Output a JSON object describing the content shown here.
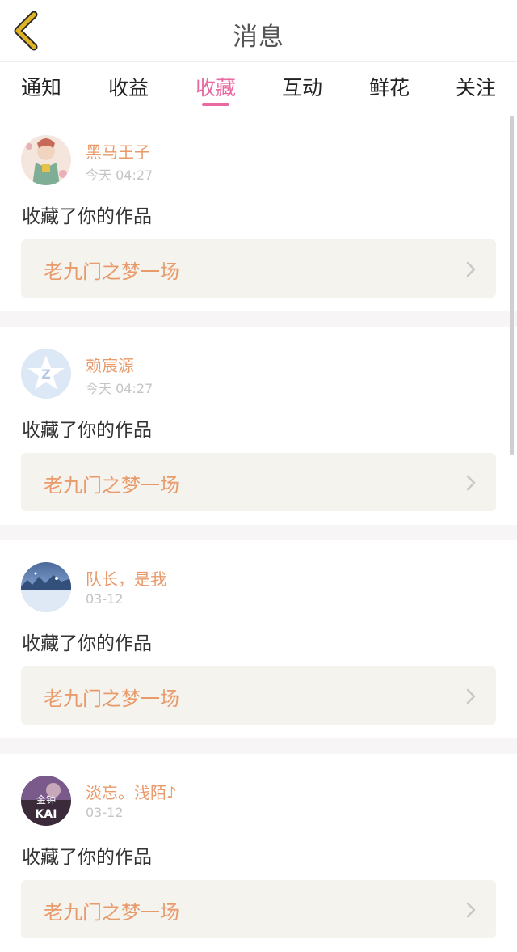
{
  "header": {
    "title": "消息"
  },
  "tabs": [
    {
      "label": "通知"
    },
    {
      "label": "收益"
    },
    {
      "label": "收藏"
    },
    {
      "label": "互动"
    },
    {
      "label": "鲜花"
    },
    {
      "label": "关注"
    }
  ],
  "active_tab": "收藏",
  "items": [
    {
      "username": "黑马王子",
      "time": "今天 04:27",
      "action": "收藏了你的作品",
      "work": "老九门之梦一场"
    },
    {
      "username": "赖宸源",
      "time": "今天 04:27",
      "action": "收藏了你的作品",
      "work": "老九门之梦一场"
    },
    {
      "username": "队长，是我",
      "time": "03-12",
      "action": "收藏了你的作品",
      "work": "老九门之梦一场"
    },
    {
      "username": "淡忘。浅陌♪",
      "time": "03-12",
      "action": "收藏了你的作品",
      "work": "老九门之梦一场"
    }
  ],
  "avatar_texts": {
    "item4": "金钟 KAI"
  },
  "colors": {
    "accent_pink": "#e86aa0",
    "username_orange": "#e89a6a",
    "time_gray": "#c4c4c4",
    "card_bg": "#f5f3ee",
    "back_arrow": "#e0b324"
  }
}
